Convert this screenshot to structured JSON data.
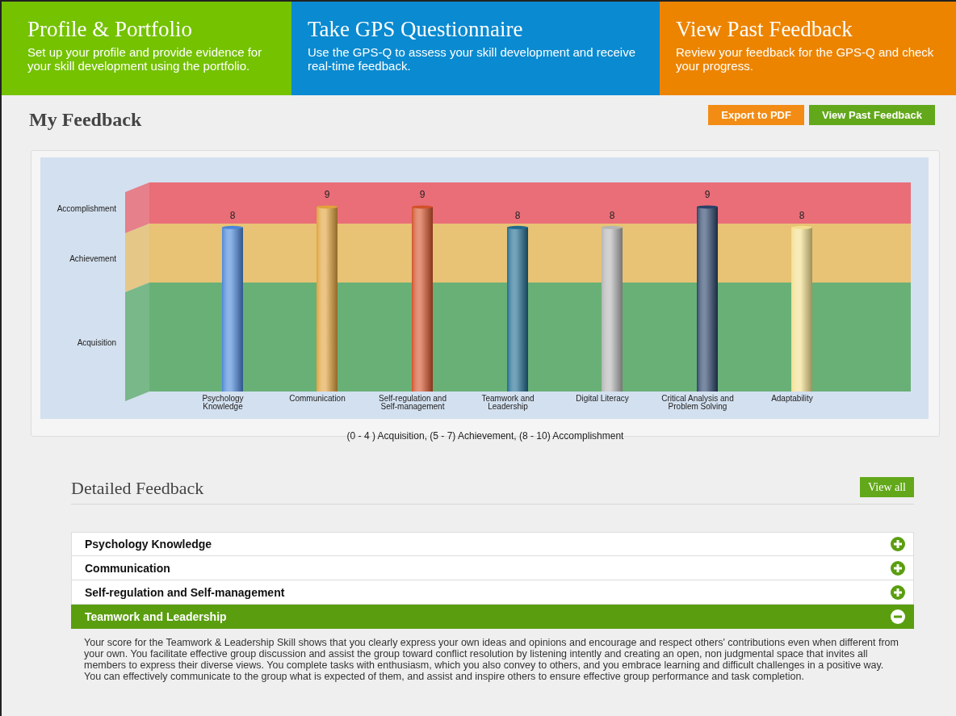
{
  "tiles": [
    {
      "kind": "green",
      "title": "Profile & Portfolio",
      "text": "Set up your profile and provide evidence for your skill development using the portfolio."
    },
    {
      "kind": "blue",
      "title": "Take GPS Questionnaire",
      "text": "Use the GPS-Q to assess your skill development and receive real-time feedback."
    },
    {
      "kind": "orange",
      "title": "View Past Feedback",
      "text": "Review your feedback for the GPS-Q and check your progress."
    }
  ],
  "page_title": "My Feedback",
  "actions": [
    {
      "kind": "orange",
      "label": "Export to PDF"
    },
    {
      "kind": "green",
      "label": "View Past Feedback"
    }
  ],
  "chart_data": {
    "type": "bar",
    "categories": [
      "Psychology\nKnowledge",
      "Communication",
      "Self-regulation and\nSelf-management",
      "Teamwork and\nLeadership",
      "Digital Literacy",
      "Critical Analysis and\nProblem Solving",
      "Adaptability"
    ],
    "series": [
      {
        "values": [
          8,
          9,
          9,
          8,
          8,
          9,
          8
        ],
        "colors": [
          "#4a86d8",
          "#e0a23c",
          "#d2512a",
          "#1f6a8e",
          "#b5b5b5",
          "#2a4268",
          "#f2df8e"
        ]
      }
    ],
    "data_labels": true
  },
  "chart_bands": [
    {
      "label": "Accomplishment",
      "color": "#e96e78"
    },
    {
      "label": "Achievement",
      "color": "#e8c275"
    },
    {
      "label": "Acquisition",
      "color": "#69b077"
    }
  ],
  "legend": "(0 - 4 ) Acquisition, (5 - 7) Achievement, (8 - 10) Accomplishment",
  "detail_title": "Detailed Feedback",
  "view_all": "View all",
  "feedback": [
    {
      "title": "Psychology Knowledge",
      "expanded": false
    },
    {
      "title": "Communication",
      "expanded": false
    },
    {
      "title": "Self-regulation and Self-management",
      "expanded": false
    },
    {
      "title": "Teamwork and Leadership",
      "expanded": true,
      "text": "Your score for the Teamwork & Leadership Skill shows that you clearly express your own ideas and opinions and encourage and respect others' contributions even when different from your own. You facilitate effective group discussion and assist the group toward conflict resolution by listening intently and creating an open, non judgmental space that invites all members to express their diverse views. You complete tasks with enthusiasm, which you also convey to others, and you embrace learning and difficult challenges in a positive way. You can effectively communicate to the group what is expected of them, and assist and inspire others to ensure effective group performance and task completion."
    }
  ]
}
